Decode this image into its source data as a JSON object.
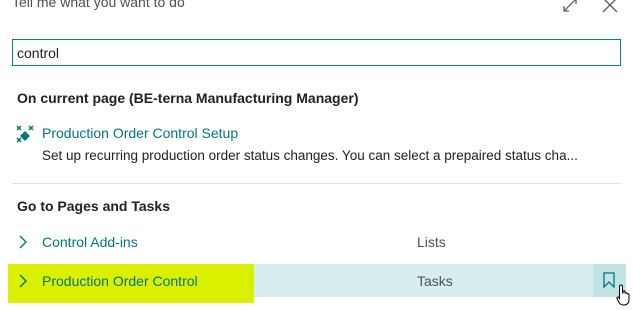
{
  "dialog": {
    "title": "Tell me what you want to do"
  },
  "search": {
    "value": "control"
  },
  "current_page": {
    "header": "On current page (BE-terna Manufacturing Manager)",
    "items": [
      {
        "title": "Production Order Control Setup",
        "description": "Set up recurring production order status changes. You can select a prepaired status cha..."
      }
    ]
  },
  "pages_tasks": {
    "header": "Go to Pages and Tasks",
    "items": [
      {
        "label": "Control Add-ins",
        "category": "Lists"
      },
      {
        "label": "Production Order Control",
        "category": "Tasks"
      }
    ]
  },
  "colors": {
    "accent": "#00787c",
    "selected_row": "#d7eef0",
    "highlighter": "#d9f000"
  },
  "icons": {
    "expand": "expand-icon",
    "close": "close-icon",
    "setup": "setup-icon",
    "chevron": "chevron-right-icon",
    "bookmark": "bookmark-icon",
    "cursor": "hand-cursor-icon"
  }
}
